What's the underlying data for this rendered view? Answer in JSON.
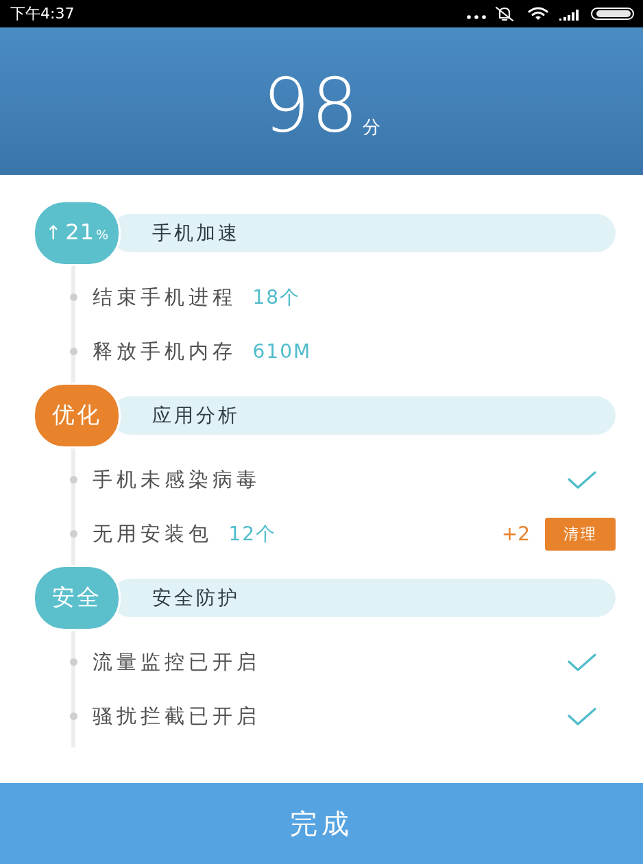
{
  "status_bar": {
    "time": "下午4:37"
  },
  "score": {
    "value": "98",
    "unit": "分"
  },
  "sections": [
    {
      "badge": {
        "prefix": "↑",
        "text": "21",
        "suffix": "%"
      },
      "color": "#5bbfcc",
      "title": "手机加速",
      "items": [
        {
          "kind": "stat",
          "label": "结束手机进程",
          "value": "18个"
        },
        {
          "kind": "stat",
          "label": "释放手机内存",
          "value": "610M"
        }
      ]
    },
    {
      "badge": {
        "text": "优化"
      },
      "color": "#e8822b",
      "title": "应用分析",
      "items": [
        {
          "kind": "check",
          "label": "手机未感染病毒"
        },
        {
          "kind": "action",
          "label": "无用安装包",
          "value": "12个",
          "gain": "+2",
          "button": "清理"
        }
      ]
    },
    {
      "badge": {
        "text": "安全"
      },
      "color": "#5bbfcc",
      "title": "安全防护",
      "items": [
        {
          "kind": "check",
          "label": "流量监控已开启"
        },
        {
          "kind": "check",
          "label": "骚扰拦截已开启"
        }
      ]
    }
  ],
  "done_button": "完成"
}
